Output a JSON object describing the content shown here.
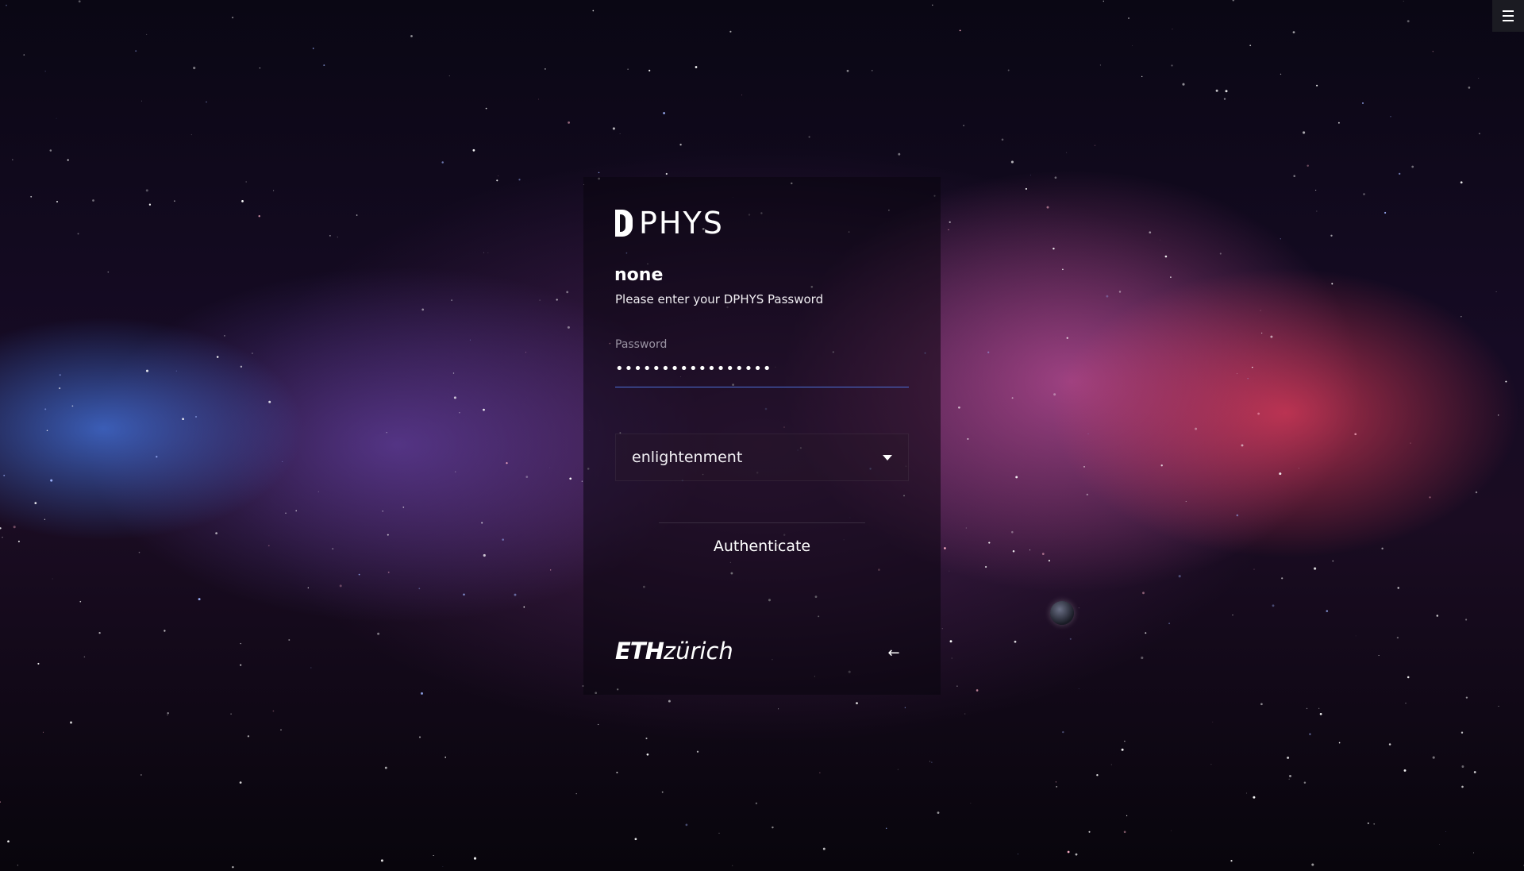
{
  "brand": {
    "text": "PHYS"
  },
  "login": {
    "username": "none",
    "instruction": "Please enter your DPHYS Password",
    "password_label": "Password",
    "password_value": "•••••••••••••••••",
    "session_value": "enlightenment",
    "submit_label": "Authenticate"
  },
  "footer": {
    "logo_bold": "ETH",
    "logo_light": "zürich",
    "back_icon": "←"
  },
  "colors": {
    "input_underline": "#4c6fd8",
    "card_background": "rgba(10,6,14,0.55)"
  },
  "icons": {
    "menu": "hamburger-icon",
    "session_dropdown": "caret-down-icon",
    "back": "arrow-left-icon"
  }
}
